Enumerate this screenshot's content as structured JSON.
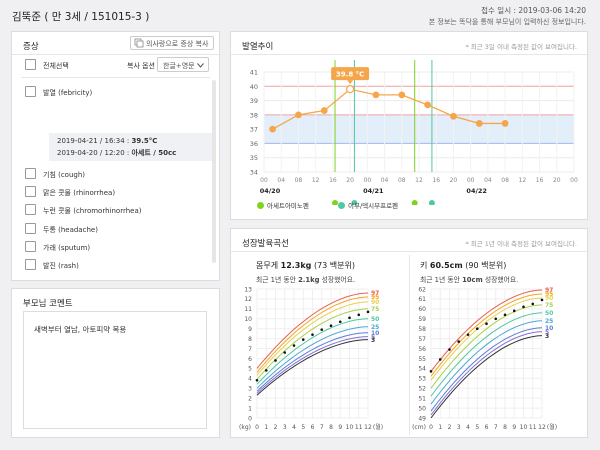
{
  "header": {
    "patient": "김뚝준 ( 만 3세 / 151015-3 )",
    "received": "접수 일시 : 2019-03-06  14:20",
    "note": "본 정보는 똑닥을 통해 부모님이 입력하신 정보입니다."
  },
  "symptoms": {
    "title": "증상",
    "copy_button": "의사랑으로 증상 복사",
    "select_all": "전체선택",
    "copy_option_label": "복사 옵션",
    "copy_option_value": "한글+영문",
    "items": [
      {
        "label": "발열 (febricity)",
        "checked": false
      },
      {
        "label": "기침 (cough)",
        "checked": false
      },
      {
        "label": "맑은 콧물 (rhinorrhea)",
        "checked": false
      },
      {
        "label": "누런 콧물 (chromorhinorrhea)",
        "checked": false
      },
      {
        "label": "두통 (headache)",
        "checked": false
      },
      {
        "label": "가래 (sputum)",
        "checked": false
      },
      {
        "label": "발진 (rash)",
        "checked": false
      }
    ],
    "fever_details": [
      {
        "time": "2019-04-21 / 16:34 : ",
        "value": "39.5°C"
      },
      {
        "time": "2019-04-20 / 12:20 : ",
        "value": "아세트 / 50cc"
      }
    ]
  },
  "comment": {
    "title": "부모님 코멘트",
    "text": "새벽부터 열남, 아토피약 복용"
  },
  "fever": {
    "title": "발열추이",
    "note": "* 최근 3일 이내 측정된 값이 보여집니다.",
    "highlight": "39.8 °C",
    "legend": [
      {
        "label": "아세트아미노펜",
        "color": "#7ed321"
      },
      {
        "label": "이부/덱시부프로펜",
        "color": "#50c8a0"
      }
    ]
  },
  "growth": {
    "title": "성장발육곡선",
    "note": "* 최근 1년 이내 측정된 값이 보여집니다.",
    "weight": {
      "title_prefix": "몸무게 ",
      "value": "12.3kg",
      "pct": " (73 백분위)",
      "sub_prefix": "최근 1년 동안 ",
      "sub_value": "2.1kg",
      "sub_suffix": " 성장했어요.",
      "unit": "(kg)",
      "month_unit": "(월)"
    },
    "height": {
      "title_prefix": "키 ",
      "value": "60.5cm",
      "pct": " (90 백분위)",
      "sub_prefix": "최근 1년 동안 ",
      "sub_value": "10cm",
      "sub_suffix": " 성장했어요.",
      "unit": "(cm)",
      "month_unit": "(월)"
    },
    "percentile_labels": [
      "97",
      "95",
      "90",
      "75",
      "50",
      "25",
      "10",
      "5",
      "3"
    ],
    "percentile_colors": [
      "#e8604c",
      "#f5a623",
      "#e8d14c",
      "#a8d14c",
      "#50c8a0",
      "#4aa8d8",
      "#5b7fd8",
      "#8a6fd8",
      "#333333"
    ]
  },
  "chart_data": [
    {
      "type": "line",
      "title": "발열추이",
      "ylim": [
        34,
        41
      ],
      "y_ticks": [
        34,
        35,
        36,
        37,
        38,
        39,
        40,
        41
      ],
      "x_tick_labels": [
        "00",
        "04",
        "08",
        "12",
        "16",
        "20",
        "00",
        "04",
        "08",
        "12",
        "16",
        "20",
        "00",
        "04",
        "08",
        "12",
        "16",
        "20",
        "00"
      ],
      "day_labels": [
        "04/20",
        "04/21",
        "04/22"
      ],
      "series": [
        {
          "values": [
            {
              "x": 2,
              "y": 37.0
            },
            {
              "x": 8,
              "y": 38.0
            },
            {
              "x": 14,
              "y": 38.3
            },
            {
              "x": 20,
              "y": 39.8
            },
            {
              "x": 26,
              "y": 39.4
            },
            {
              "x": 32,
              "y": 39.4
            },
            {
              "x": 38,
              "y": 38.7
            },
            {
              "x": 44,
              "y": 37.9
            },
            {
              "x": 50,
              "y": 37.4
            },
            {
              "x": 56,
              "y": 37.4
            }
          ]
        }
      ],
      "doses": [
        {
          "x": 16.5,
          "kind": "아세트아미노펜"
        },
        {
          "x": 21,
          "kind": "이부/덱시부프로펜"
        },
        {
          "x": 35,
          "kind": "아세트아미노펜"
        },
        {
          "x": 39,
          "kind": "이부/덱시부프로펜"
        }
      ],
      "normal_band": [
        36,
        38
      ]
    },
    {
      "type": "line",
      "title": "몸무게",
      "xlabel": "(월)",
      "ylabel": "(kg)",
      "xlim": [
        0,
        12
      ],
      "ylim": [
        0,
        13
      ],
      "percentiles": [
        "97",
        "95",
        "90",
        "75",
        "50",
        "25",
        "10",
        "5",
        "3"
      ],
      "series_start": [
        5.0,
        4.6,
        4.3,
        3.9,
        3.4,
        3.0,
        2.7,
        2.5,
        2.3
      ],
      "series_end": [
        12.6,
        12.2,
        11.7,
        11.0,
        10.0,
        9.2,
        8.6,
        8.2,
        7.9
      ],
      "points": [
        {
          "x": 0,
          "y": 3.8
        },
        {
          "x": 1,
          "y": 4.8
        },
        {
          "x": 2,
          "y": 5.8
        },
        {
          "x": 3,
          "y": 6.6
        },
        {
          "x": 4,
          "y": 7.3
        },
        {
          "x": 5,
          "y": 7.9
        },
        {
          "x": 6,
          "y": 8.4
        },
        {
          "x": 7,
          "y": 8.9
        },
        {
          "x": 8,
          "y": 9.3
        },
        {
          "x": 9,
          "y": 9.7
        },
        {
          "x": 10,
          "y": 10.1
        },
        {
          "x": 11,
          "y": 10.4
        },
        {
          "x": 12,
          "y": 10.7
        }
      ]
    },
    {
      "type": "line",
      "title": "키",
      "xlabel": "(월)",
      "ylabel": "(cm)",
      "xlim": [
        0,
        12
      ],
      "ylim": [
        49,
        62
      ],
      "percentiles": [
        "97",
        "95",
        "90",
        "75",
        "50",
        "25",
        "10",
        "5",
        "3"
      ],
      "series_start": [
        53.7,
        53.2,
        52.8,
        52.0,
        51.2,
        50.4,
        49.7,
        49.3,
        49.0
      ],
      "series_end": [
        61.9,
        61.5,
        61.1,
        60.4,
        59.6,
        58.8,
        58.1,
        57.7,
        57.3
      ],
      "points": [
        {
          "x": 0,
          "y": 53.7
        },
        {
          "x": 1,
          "y": 54.9
        },
        {
          "x": 2,
          "y": 55.9
        },
        {
          "x": 3,
          "y": 56.7
        },
        {
          "x": 4,
          "y": 57.4
        },
        {
          "x": 5,
          "y": 58.0
        },
        {
          "x": 6,
          "y": 58.5
        },
        {
          "x": 7,
          "y": 59.0
        },
        {
          "x": 8,
          "y": 59.4
        },
        {
          "x": 9,
          "y": 59.8
        },
        {
          "x": 10,
          "y": 60.2
        },
        {
          "x": 11,
          "y": 60.5
        },
        {
          "x": 12,
          "y": 60.9
        }
      ]
    }
  ]
}
